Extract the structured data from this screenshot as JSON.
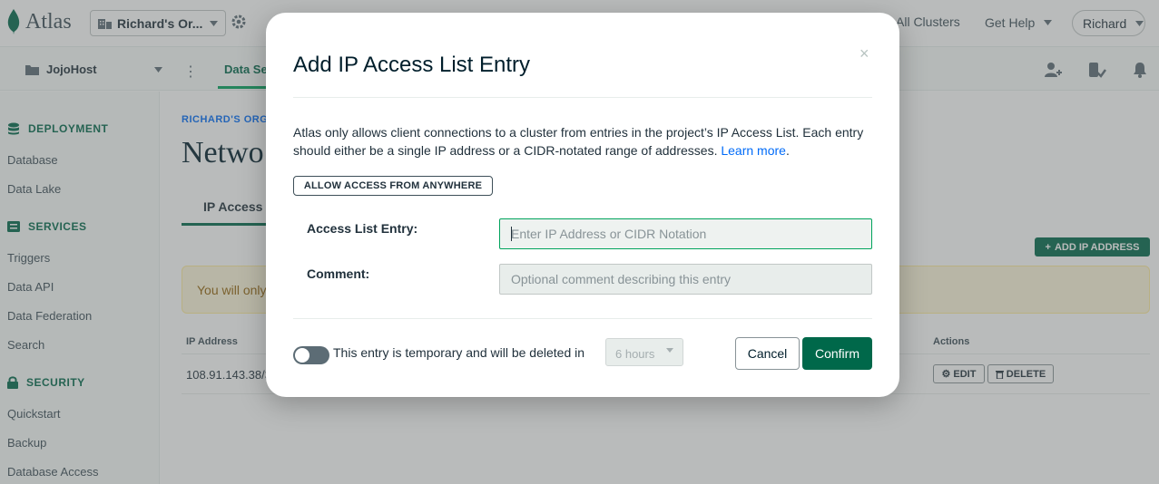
{
  "topbar": {
    "logo": "Atlas",
    "org_name": "Richard's Or...",
    "all_clusters": "All Clusters",
    "get_help": "Get Help",
    "user": "Richard"
  },
  "projectbar": {
    "project": "JojoHost",
    "tab": "Data Se"
  },
  "sidebar": {
    "deployment": {
      "title": "DEPLOYMENT",
      "items": [
        "Database",
        "Data Lake"
      ]
    },
    "services": {
      "title": "SERVICES",
      "items": [
        "Triggers",
        "Data API",
        "Data Federation",
        "Search"
      ]
    },
    "security": {
      "title": "SECURITY",
      "items": [
        "Quickstart",
        "Backup",
        "Database Access"
      ]
    }
  },
  "main": {
    "breadcrumb": "RICHARD'S ORG",
    "title": "Netwo",
    "tab": "IP Access",
    "add_ip_button": "ADD IP ADDRESS",
    "banner": "You will only",
    "table": {
      "col_ip": "IP Address",
      "col_actions": "Actions",
      "row_ip": "108.91.143.38/3",
      "edit": "EDIT",
      "delete": "DELETE"
    }
  },
  "modal": {
    "title": "Add IP Access List Entry",
    "close": "×",
    "description": "Atlas only allows client connections to a cluster from entries in the project’s IP Access List. Each entry should either be a single IP address or a CIDR-notated range of addresses.",
    "learn_more": "Learn more",
    "allow_anywhere": "ALLOW ACCESS FROM ANYWHERE",
    "access_label": "Access List Entry:",
    "access_placeholder": "Enter IP Address or CIDR Notation",
    "access_value": "",
    "comment_label": "Comment:",
    "comment_placeholder": "Optional comment describing this entry",
    "comment_value": "",
    "temporary_label": "This entry is temporary and will be deleted in",
    "temporary_enabled": false,
    "hours": "6 hours",
    "cancel": "Cancel",
    "confirm": "Confirm"
  },
  "colors": {
    "brand_green": "#00684a",
    "accent_green": "#00a35c",
    "link_blue": "#016bf8"
  }
}
